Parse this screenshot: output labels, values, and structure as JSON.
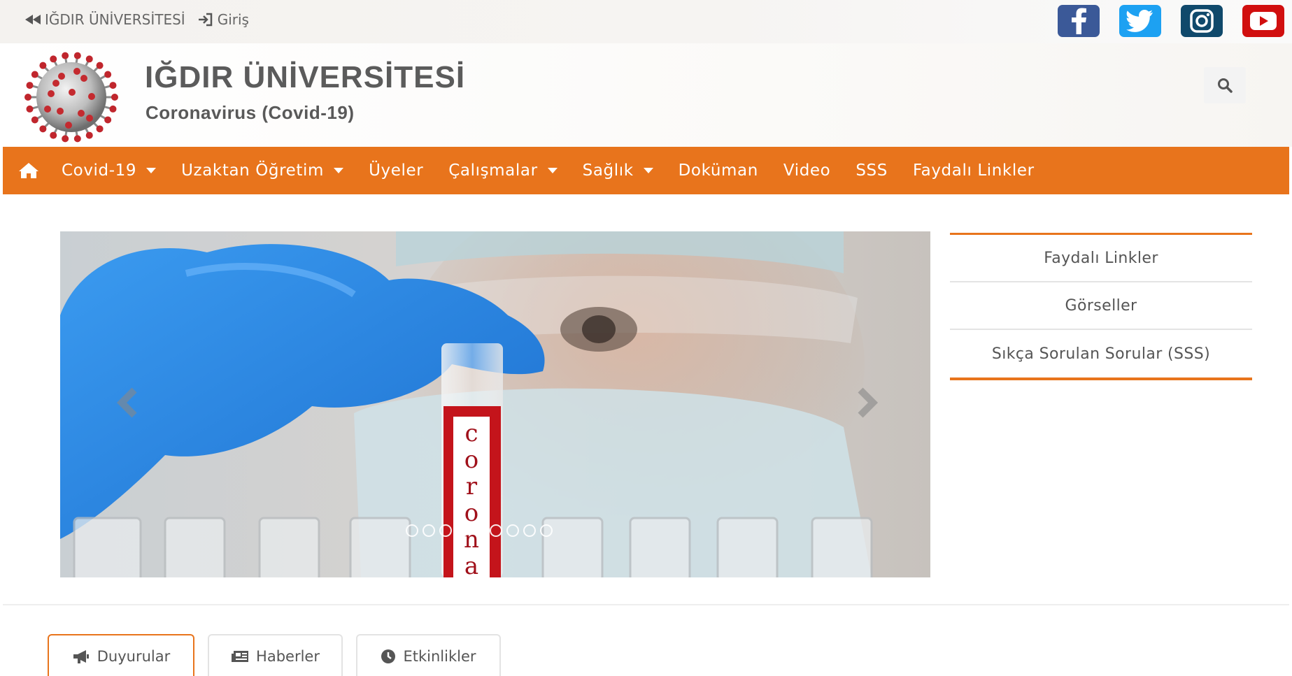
{
  "topbar": {
    "home_link": "IĞDIR ÜNİVERSİTESİ",
    "login_link": "Giriş",
    "socials": [
      {
        "name": "facebook-icon",
        "color": "#3b5998"
      },
      {
        "name": "twitter-icon",
        "color": "#1da1f2"
      },
      {
        "name": "instagram-icon",
        "color": "#10496b"
      },
      {
        "name": "youtube-icon",
        "color": "#d10f0f"
      }
    ]
  },
  "header": {
    "title": "IĞDIR ÜNİVERSİTESİ",
    "subtitle": "Coronavirus (Covid-19)",
    "search_icon": "search-icon"
  },
  "nav": {
    "home_icon": "home-icon",
    "items": [
      {
        "label": "Covid-19",
        "dropdown": true
      },
      {
        "label": "Uzaktan Öğretim",
        "dropdown": true
      },
      {
        "label": "Üyeler",
        "dropdown": false
      },
      {
        "label": "Çalışmalar",
        "dropdown": true
      },
      {
        "label": "Sağlık",
        "dropdown": true
      },
      {
        "label": "Doküman",
        "dropdown": false
      },
      {
        "label": "Video",
        "dropdown": false
      },
      {
        "label": "SSS",
        "dropdown": false
      },
      {
        "label": "Faydalı Linkler",
        "dropdown": false
      }
    ],
    "background": "#e8741c"
  },
  "slider": {
    "tube_label": "corona",
    "slide_count": 9,
    "active_index": 4
  },
  "sidemenu": {
    "items": [
      "Faydalı Linkler",
      "Görseller",
      "Sıkça Sorulan Sorular (SSS)"
    ]
  },
  "tabs": [
    {
      "label": "Duyurular",
      "icon": "megaphone-icon",
      "active": true
    },
    {
      "label": "Haberler",
      "icon": "newspaper-icon",
      "active": false
    },
    {
      "label": "Etkinlikler",
      "icon": "clock-icon",
      "active": false
    }
  ]
}
